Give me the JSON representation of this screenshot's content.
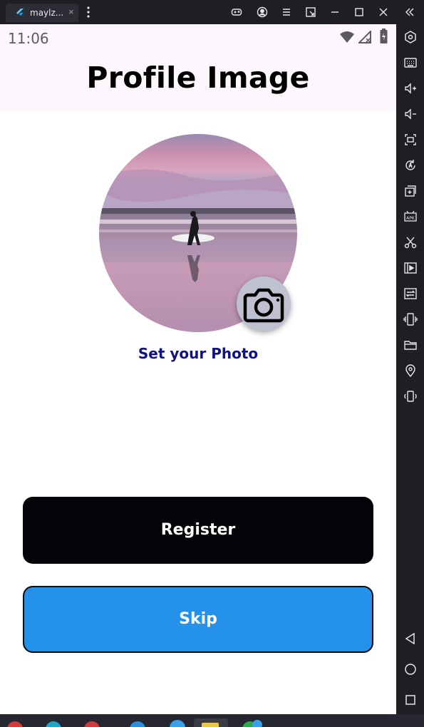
{
  "window": {
    "tab_title": "maylz...",
    "close_glyph": "×"
  },
  "status_bar": {
    "time": "11:06"
  },
  "app": {
    "title": "Profile Image",
    "set_photo_label": "Set your Photo",
    "register_label": "Register",
    "skip_label": "Skip"
  },
  "colors": {
    "register_bg": "#040308",
    "skip_bg": "#2491ea",
    "set_photo_text": "#111184",
    "appbar_bg": "#fdf7fd"
  },
  "toolbar_icons": [
    "gamepad-icon",
    "account-icon",
    "menu-icon",
    "resize-icon",
    "minimize-icon",
    "maximize-icon",
    "close-icon",
    "collapse-sidebar-icon"
  ],
  "sidebar_icons": [
    "settings-hex-icon",
    "keyboard-icon",
    "volume-up-icon",
    "volume-down-icon",
    "screenshot-icon",
    "rotate-icon",
    "add-window-icon",
    "apk-icon",
    "scissors-icon",
    "record-icon",
    "sync-icon",
    "shake-icon",
    "folder-icon",
    "location-icon",
    "vibrate-icon"
  ],
  "nav_icons": [
    "back-icon",
    "home-icon",
    "recents-icon"
  ]
}
